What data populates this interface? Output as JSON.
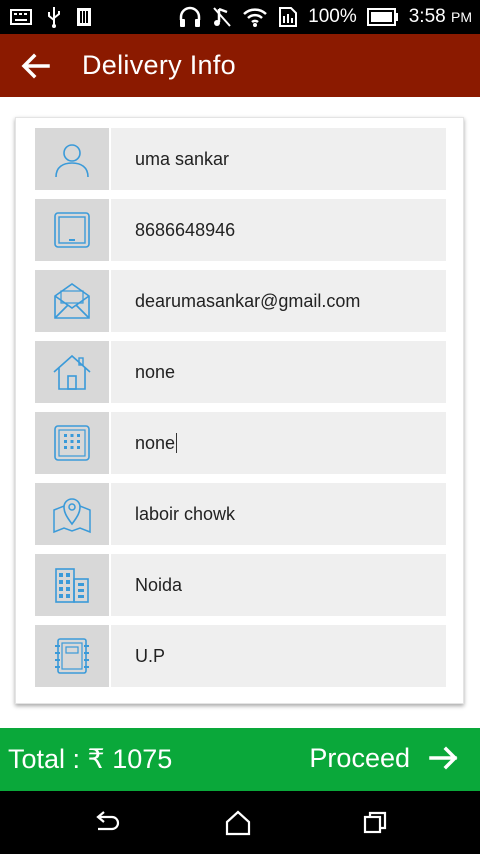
{
  "status_bar": {
    "battery": "100%",
    "time": "3:58",
    "ampm": "PM"
  },
  "app_bar": {
    "title": "Delivery Info"
  },
  "fields": [
    {
      "icon": "person-icon",
      "value": "uma sankar"
    },
    {
      "icon": "tablet-icon",
      "value": "8686648946"
    },
    {
      "icon": "envelope-icon",
      "value": "dearumasankar@gmail.com"
    },
    {
      "icon": "house-icon",
      "value": "none"
    },
    {
      "icon": "building-grid-icon",
      "value": "none"
    },
    {
      "icon": "map-pin-icon",
      "value": "laboir chowk"
    },
    {
      "icon": "city-buildings-icon",
      "value": "Noida"
    },
    {
      "icon": "notebook-icon",
      "value": "U.P"
    }
  ],
  "bottom_bar": {
    "total": "Total :  ₹ 1075",
    "proceed_label": "Proceed"
  },
  "colors": {
    "app_bar": "#8b1a00",
    "bottom_bar": "#0aa83a",
    "icon_blue": "#3a9ad9"
  }
}
